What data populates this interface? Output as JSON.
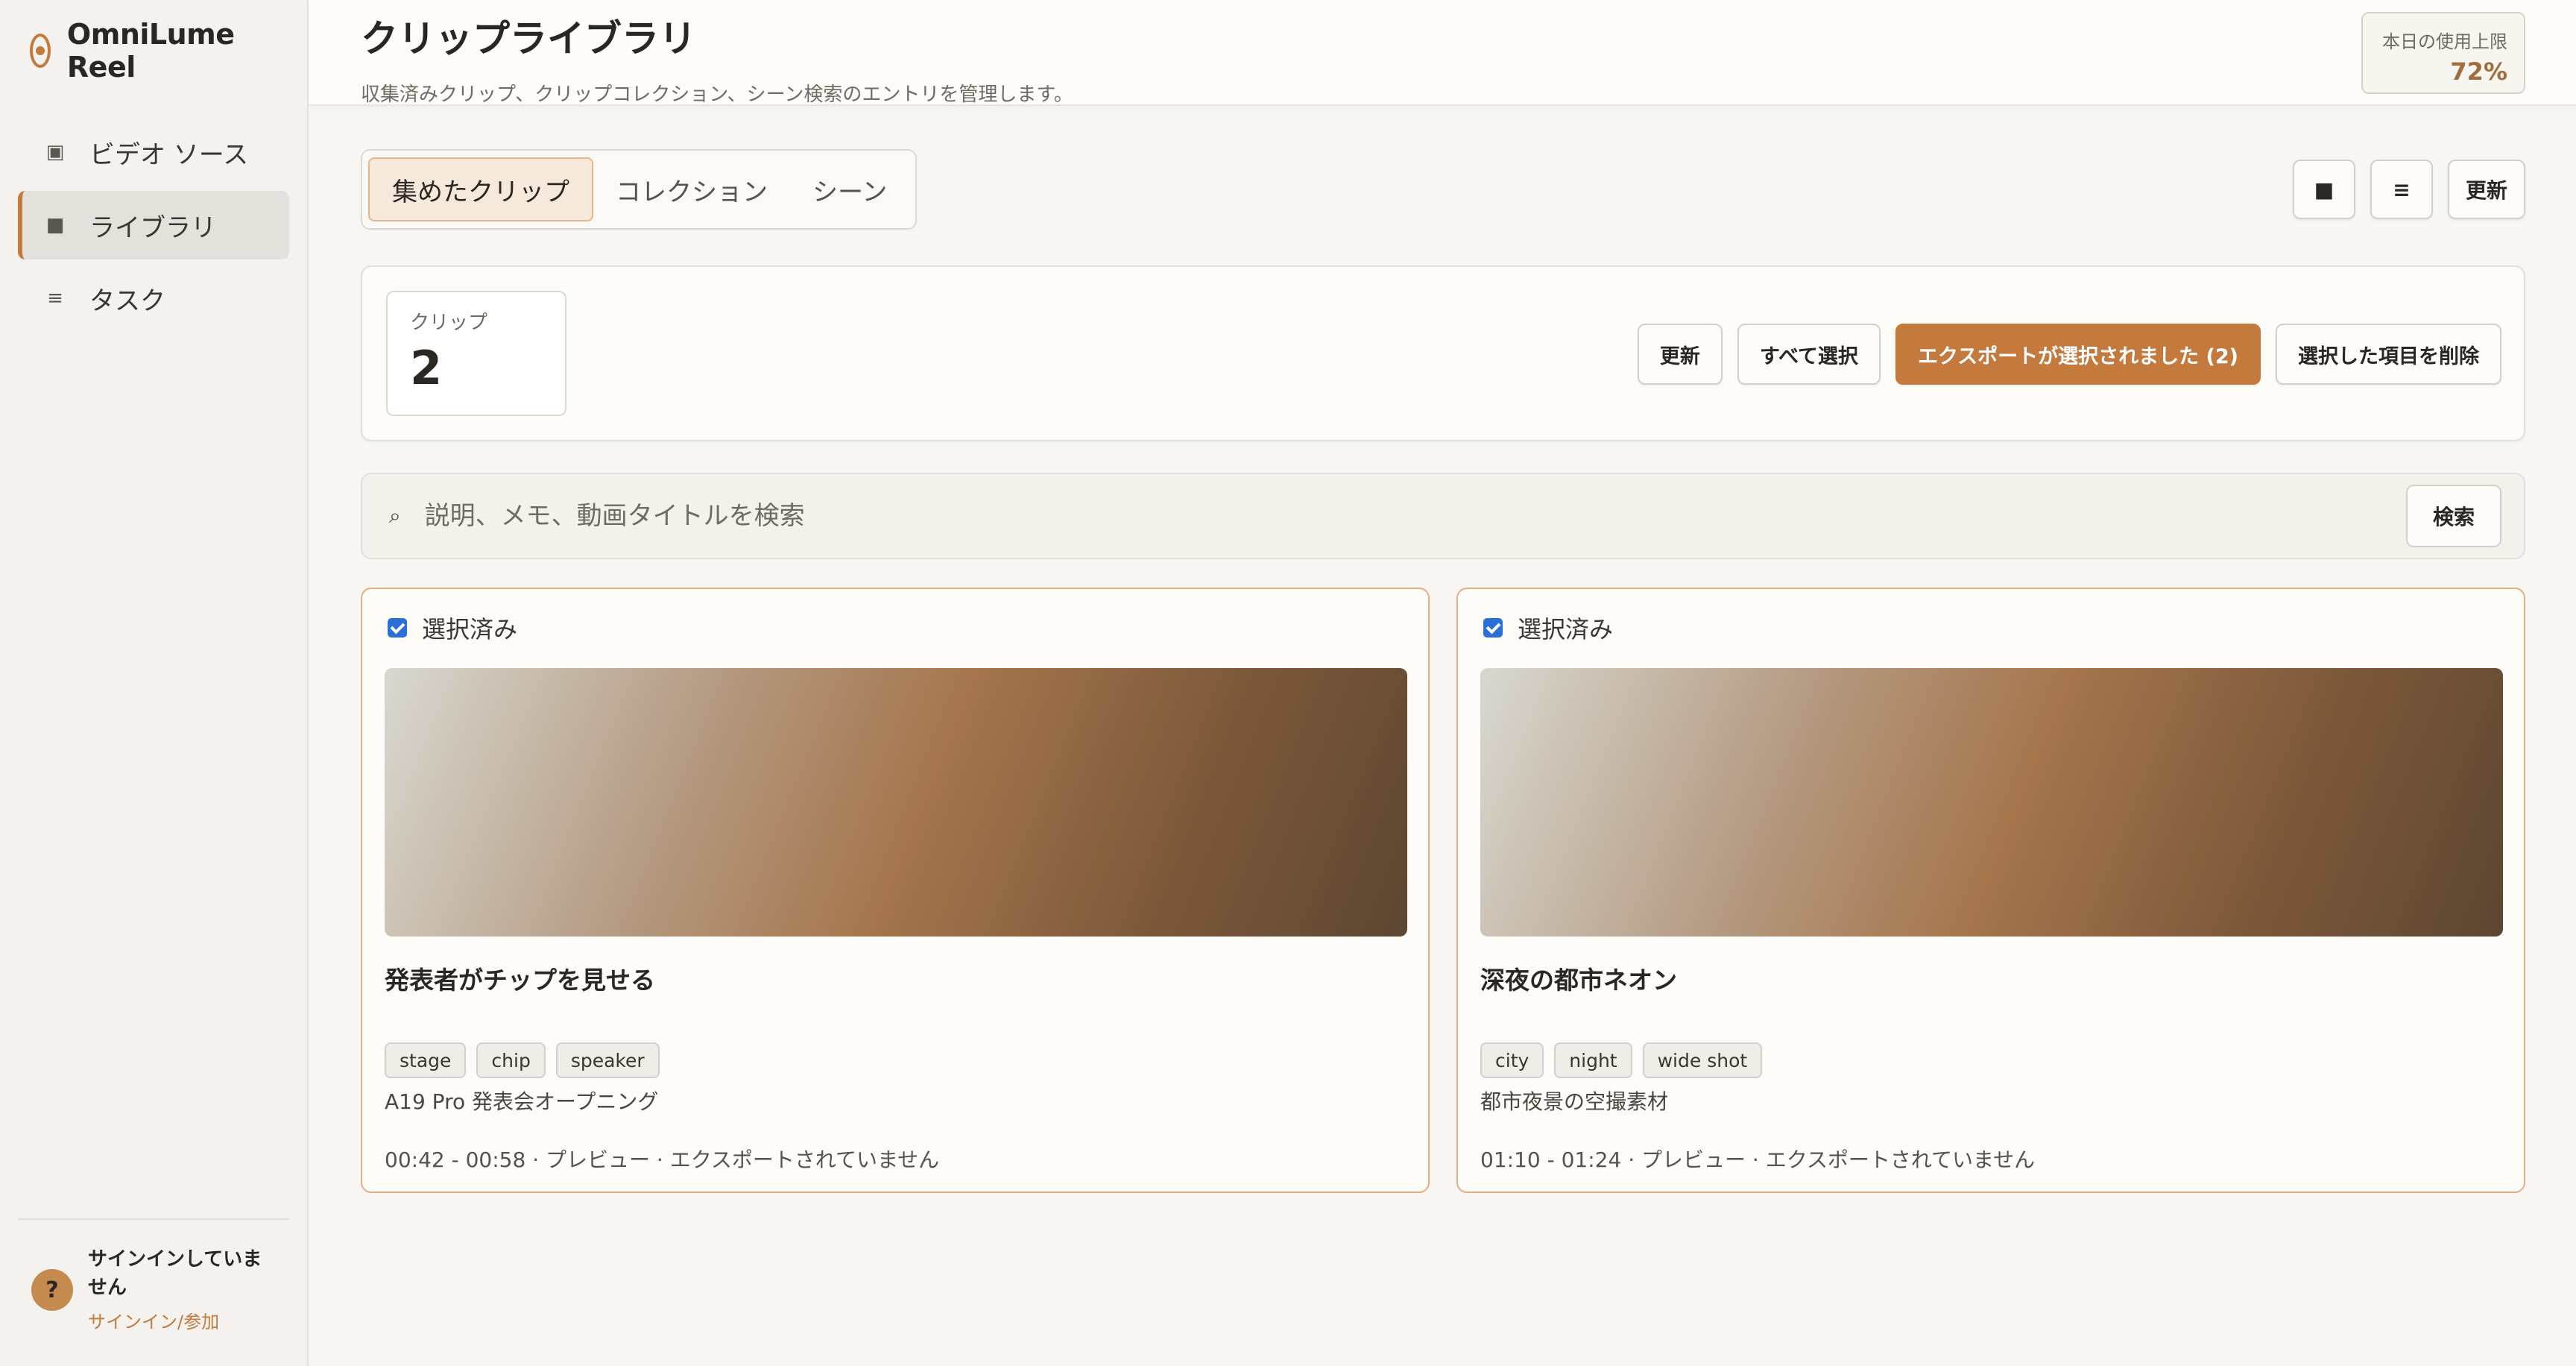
{
  "brand": {
    "name": "OmniLume Reel"
  },
  "sidebar": {
    "items": [
      {
        "label": "ビデオ ソース",
        "icon": "video-source-icon",
        "active": false
      },
      {
        "label": "ライブラリ",
        "icon": "library-icon",
        "active": true
      },
      {
        "label": "タスク",
        "icon": "tasks-icon",
        "active": false
      }
    ],
    "footer": {
      "avatar_text": "?",
      "status": "サインインしていません",
      "link": "サインイン/参加"
    }
  },
  "header": {
    "title": "クリップライブラリ",
    "subtitle": "収集済みクリップ、クリップコレクション、シーン検索のエントリを管理します。",
    "usage_label": "本日の使用上限",
    "usage_value": "72%"
  },
  "tabs": [
    {
      "label": "集めたクリップ",
      "active": true
    },
    {
      "label": "コレクション",
      "active": false
    },
    {
      "label": "シーン",
      "active": false
    }
  ],
  "toolbar": {
    "grid_glyph": "■",
    "list_glyph": "≡",
    "refresh_label": "更新"
  },
  "stats": {
    "label": "クリップ",
    "value": "2"
  },
  "actions": {
    "refresh": "更新",
    "select_all": "すべて選択",
    "export_selected": "エクスポートが選択されました (2)",
    "delete_selected": "選択した項目を削除"
  },
  "search": {
    "icon_glyph": "⌕",
    "placeholder": "説明、メモ、動画タイトルを検索",
    "value": "",
    "button": "検索"
  },
  "clips": [
    {
      "selected_label": "選択済み",
      "title": "発表者がチップを見せる",
      "tags": [
        "stage",
        "chip",
        "speaker"
      ],
      "description": "A19 Pro 発表会オープニング",
      "meta": "00:42 - 00:58 · プレビュー · エクスポートされていません"
    },
    {
      "selected_label": "選択済み",
      "title": "深夜の都市ネオン",
      "tags": [
        "city",
        "night",
        "wide shot"
      ],
      "description": "都市夜景の空撮素材",
      "meta": "01:10 - 01:24 · プレビュー · エクスポートされていません"
    }
  ],
  "colors": {
    "accent": "#c47a3c",
    "selected_border": "#e4ad82",
    "checkbox": "#2a6fd6"
  }
}
